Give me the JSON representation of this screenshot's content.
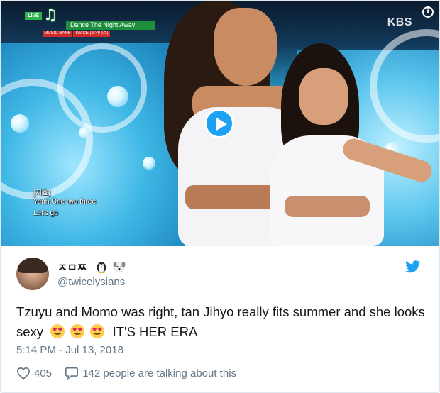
{
  "media": {
    "broadcast": {
      "live_label": "LIVE",
      "song_title": "Dance The Night Away",
      "sub_label_1": "MUSIC BANK",
      "sub_label_2": "TWICE (트와이스)",
      "channel": "KBS"
    },
    "captions": [
      "[지효]",
      "Yeah One two three",
      "Let's go"
    ],
    "info_glyph": "i",
    "play_icon": "play-icon"
  },
  "author": {
    "name": "ㅈㅁㅉ",
    "emojis": [
      "penguin-emoji",
      "dog-emoji"
    ],
    "handle": "@twicelysians",
    "platform_icon": "twitter-bird-icon"
  },
  "tweet": {
    "text_part_1": "Tzuyu and Momo was right, tan Jihyo really fits summer and she looks sexy",
    "emojis": [
      "heart-eyes-emoji",
      "heart-eyes-emoji",
      "heart-eyes-emoji"
    ],
    "text_part_2": "IT'S HER ERA",
    "timestamp": "5:14 PM - Jul 13, 2018"
  },
  "actions": {
    "likes": "405",
    "comments": "142 people are talking about this"
  },
  "colors": {
    "accent": "#1da1f2",
    "text_primary": "#14171a",
    "text_secondary": "#657786",
    "border": "#e1e8ed"
  }
}
